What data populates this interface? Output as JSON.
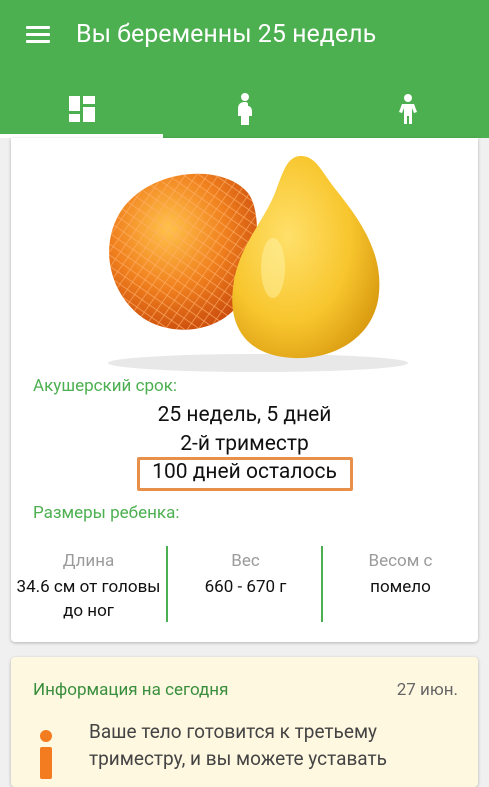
{
  "app": {
    "title": "Вы беременны 25 недель",
    "accent_color": "#4caf50",
    "menu_icon": "hamburger-menu-icon"
  },
  "tabs": [
    {
      "icon": "dashboard-icon",
      "selected": true
    },
    {
      "icon": "pregnant-woman-icon",
      "selected": false
    },
    {
      "icon": "child-icon",
      "selected": false
    }
  ],
  "week_card": {
    "fruit_image": "pomelo-fruit-illustration",
    "term_label": "Акушерский срок:",
    "term_value": "25 недель, 5 дней",
    "trimester": "2-й триместр",
    "days_left": "100 дней осталось",
    "size_label": "Размеры ребенка:",
    "stats": [
      {
        "label": "Длина",
        "value": "34.6 см от головы до ног"
      },
      {
        "label": "Вес",
        "value": "660 - 670 г"
      },
      {
        "label": "Весом с",
        "value": "помело"
      }
    ]
  },
  "info_card": {
    "title": "Информация на сегодня",
    "date": "27 июн.",
    "icon": "info-icon",
    "text": "Ваше тело готовится к третьему триместру, и вы можете уставать"
  }
}
